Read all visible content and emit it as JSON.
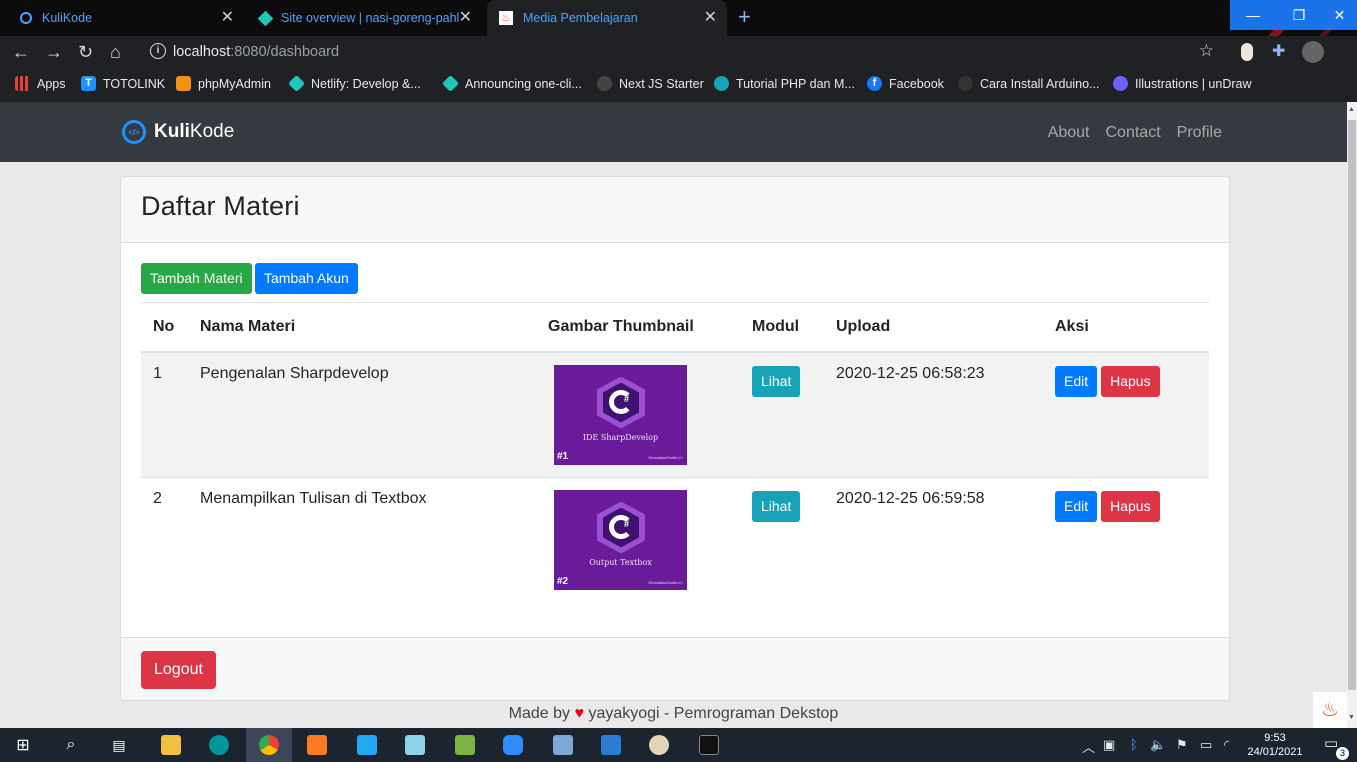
{
  "browser": {
    "tabs": [
      {
        "title": "KuliKode",
        "icon": "circle-icon",
        "active": false
      },
      {
        "title": "Site overview | nasi-goreng-pahlа",
        "icon": "netlify-icon",
        "active": false
      },
      {
        "title": "Media Pembelajaran",
        "icon": "codeigniter-icon",
        "active": true
      }
    ],
    "new_tab": "+",
    "url_host": "localhost",
    "url_rest": ":8080/dashboard",
    "bookmarks": [
      {
        "label": "Apps",
        "icon": "apps-grid-icon"
      },
      {
        "label": "TOTOLINK",
        "icon": "totolink-icon"
      },
      {
        "label": "phpMyAdmin",
        "icon": "phpmyadmin-icon"
      },
      {
        "label": "Netlify: Develop &...",
        "icon": "netlify-icon"
      },
      {
        "label": "Announcing one-cli...",
        "icon": "netlify-icon"
      },
      {
        "label": "Next JS Starter",
        "icon": "github-icon"
      },
      {
        "label": "Tutorial PHP dan M...",
        "icon": "site-icon"
      },
      {
        "label": "Facebook",
        "icon": "facebook-icon"
      },
      {
        "label": "Cara Install Arduino...",
        "icon": "site-icon"
      },
      {
        "label": "Illustrations | unDraw",
        "icon": "undraw-icon"
      }
    ]
  },
  "app": {
    "brand_bold": "Kuli",
    "brand_rest": "Kode",
    "nav": [
      "About",
      "Contact",
      "Profile"
    ],
    "page_title": "Daftar Materi",
    "btn_add_materi": "Tambah Materi",
    "btn_add_akun": "Tambah Akun",
    "table": {
      "headers": [
        "No",
        "Nama Materi",
        "Gambar Thumbnail",
        "Modul",
        "Upload",
        "Aksi"
      ],
      "rows": [
        {
          "no": "1",
          "nama": "Pengenalan Sharpdevelop",
          "thumb_caption": "IDE SharpDevelop",
          "thumb_num": "#1",
          "modul": "Lihat",
          "upload": "2020-12-25 06:58:23",
          "edit": "Edit",
          "hapus": "Hapus"
        },
        {
          "no": "2",
          "nama": "Menampilkan Tulisan di Textbox",
          "thumb_caption": "Output Textbox",
          "thumb_num": "#2",
          "modul": "Lihat",
          "upload": "2020-12-25 06:59:58",
          "edit": "Edit",
          "hapus": "Hapus"
        }
      ]
    },
    "thumb_signature": "GinantakaGodie</>",
    "logout": "Logout",
    "footer_prefix": "Made by",
    "footer_suffix": "yayakyogi - Pemrograman Dekstop"
  },
  "taskbar": {
    "time": "9:53",
    "date": "24/01/2021",
    "notifications": "3"
  }
}
